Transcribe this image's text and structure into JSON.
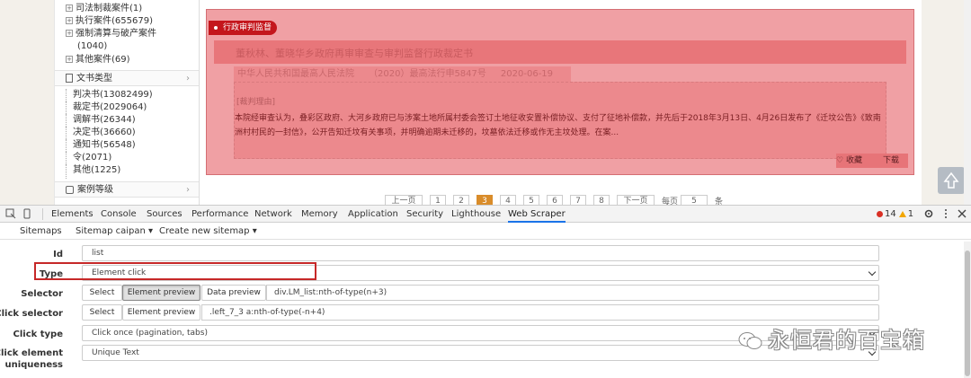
{
  "tree": {
    "items": [
      {
        "label": "司法制裁案件(1)"
      },
      {
        "label": "执行案件(655679)"
      },
      {
        "label": "强制清算与破产案件"
      },
      {
        "label": "(1040)"
      },
      {
        "label": "其他案件(69)"
      }
    ],
    "doc_type_section": "文书类型",
    "doc_types": [
      "判决书(13082499)",
      "裁定书(2029064)",
      "调解书(26344)",
      "决定书(36660)",
      "通知书(56548)",
      "令(2071)",
      "其他(1225)"
    ],
    "level_section": "案例等级"
  },
  "result": {
    "badge": "行政审判监督",
    "title": "董秋林、董晓华乡政府再审审查与审判监督行政裁定书",
    "court": "中华人民共和国最高人民法院",
    "case_no": "（2020）最高法行申5847号",
    "date": "2020-06-19",
    "reason_label": "[裁判理由]",
    "reason_text": "本院经审查认为，叠彩区政府、大河乡政府已与涉案土地所属村委会签订土地征收安置补偿协议、支付了征地补偿款，并先后于2018年3月13日、4月26日发布了《迁坟公告》《致南洲村村民的一封信》，公开告知迁坟有关事项，并明确逾期未迁移的，坟墓依法迁移或作无主坟处理。在案...",
    "fav_label": "收藏",
    "download_label": "下载"
  },
  "pager": {
    "prev": "上一页",
    "pages": [
      "1",
      "2",
      "3",
      "4",
      "5",
      "6",
      "7",
      "8"
    ],
    "active_page": "3",
    "next": "下一页",
    "per_page": "每页",
    "per_page_value": "5",
    "unit": "条"
  },
  "devtools": {
    "tabs": [
      "Elements",
      "Console",
      "Sources",
      "Performance",
      "Network",
      "Memory",
      "Application",
      "Security",
      "Lighthouse",
      "Web Scraper"
    ],
    "active_tab": "Web Scraper",
    "errors": "14",
    "warnings": "1",
    "subnav": {
      "sitemaps": "Sitemaps",
      "sitemap_name": "Sitemap caipan",
      "create": "Create new sitemap"
    },
    "form": {
      "id_label": "Id",
      "id_value": "list",
      "type_label": "Type",
      "type_value": "Element click",
      "selector_label": "Selector",
      "select_btn": "Select",
      "element_preview_btn": "Element preview",
      "data_preview_btn": "Data preview",
      "selector_value": "div.LM_list:nth-of-type(n+3)",
      "click_selector_label": "Click selector",
      "click_select_btn": "Select",
      "click_element_preview_btn": "Element preview",
      "click_selector_value": ".left_7_3 a:nth-of-type(-n+4)",
      "click_type_label": "Click type",
      "click_type_value": "Click once (pagination, tabs)",
      "click_uniqueness_label_1": "Click element",
      "click_uniqueness_label_2": "uniqueness",
      "click_uniqueness_value": "Unique Text"
    }
  },
  "watermark": "永恒君的百宝箱",
  "colors": {
    "highlight_fill": "#f0a0a4",
    "highlight_border": "#d46e73",
    "badge_red": "#c4161c",
    "active_page": "#d98c2a",
    "type_box": "#c62828",
    "devtools_accent": "#1a73e8"
  }
}
